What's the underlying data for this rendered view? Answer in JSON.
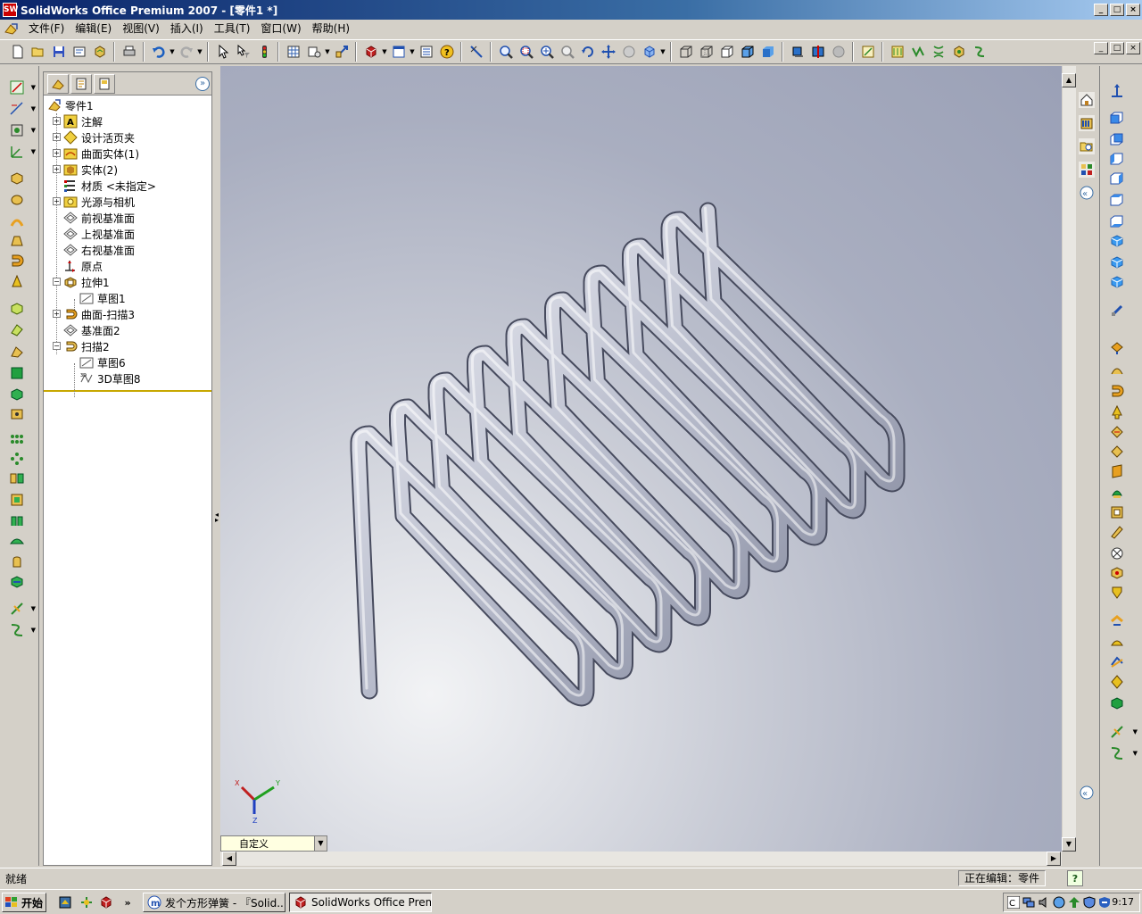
{
  "window": {
    "title": "SolidWorks Office Premium 2007 - [零件1 *]",
    "app_icon_text": "SW",
    "minimize": "_",
    "maximize": "□",
    "close": "×"
  },
  "menubar": {
    "items": [
      "文件(F)",
      "编辑(E)",
      "视图(V)",
      "插入(I)",
      "工具(T)",
      "窗口(W)",
      "帮助(H)"
    ]
  },
  "feature_tree": {
    "root": "零件1",
    "items": [
      {
        "label": "注解",
        "icon": "annotations-icon"
      },
      {
        "label": "设计活页夹",
        "icon": "design-binder-icon"
      },
      {
        "label": "曲面实体(1)",
        "icon": "surface-bodies-icon"
      },
      {
        "label": "实体(2)",
        "icon": "solid-bodies-icon"
      },
      {
        "label": "材质 <未指定>",
        "icon": "material-icon"
      },
      {
        "label": "光源与相机",
        "icon": "lights-cameras-icon"
      },
      {
        "label": "前视基准面",
        "icon": "plane-icon"
      },
      {
        "label": "上视基准面",
        "icon": "plane-icon"
      },
      {
        "label": "右视基准面",
        "icon": "plane-icon"
      },
      {
        "label": "原点",
        "icon": "origin-icon"
      },
      {
        "label": "拉伸1",
        "icon": "extrude-icon"
      },
      {
        "label": "草图1",
        "icon": "sketch-icon"
      },
      {
        "label": "曲面-扫描3",
        "icon": "surface-sweep-icon"
      },
      {
        "label": "基准面2",
        "icon": "plane-icon"
      },
      {
        "label": "扫描2",
        "icon": "sweep-icon"
      },
      {
        "label": "草图6",
        "icon": "sketch-icon"
      },
      {
        "label": "3D草图8",
        "icon": "sketch-3d-icon"
      }
    ],
    "expand_button": "»"
  },
  "viewport": {
    "view_orientation": "自定义",
    "triad_labels": {
      "x": "X",
      "y": "Y",
      "z": "Z"
    }
  },
  "statusbar": {
    "status": "就绪",
    "mode": "正在编辑：零件",
    "help": "?"
  },
  "taskbar": {
    "start_label": "开始",
    "quicklaunch_more": "»",
    "tasks": [
      {
        "label": "发个方形弹簧 - 『Solid..."
      },
      {
        "label": "SolidWorks Office Premiu..."
      }
    ],
    "clock": "9:17"
  },
  "colors": {
    "titlebar_start": "#0a246a",
    "titlebar_end": "#a6caf0",
    "chrome": "#d4d0c8",
    "tree_separator": "#c8a800"
  }
}
